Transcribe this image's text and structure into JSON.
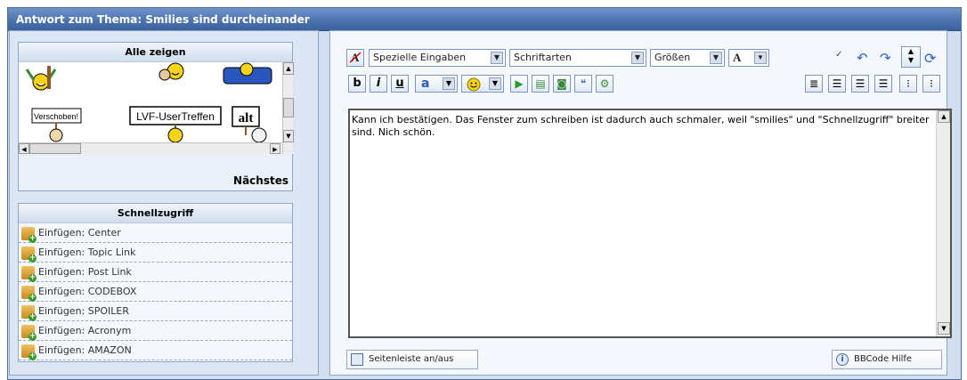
{
  "window": {
    "title": "Antwort zum Thema: Smilies sind durcheinander"
  },
  "smilies": {
    "header": "Alle zeigen",
    "items": [
      "Verschoben!",
      "LVF-UserTreffen",
      "alt"
    ],
    "next_label": "Nächstes"
  },
  "quick": {
    "header": "Schnellzugriff",
    "items": [
      "Einfügen: Center",
      "Einfügen: Topic Link",
      "Einfügen: Post Link",
      "Einfügen: CODEBOX",
      "Einfügen: SPOILER",
      "Einfügen: Acronym",
      "Einfügen: AMAZON"
    ]
  },
  "toolbar": {
    "special_select": "Spezielle Eingaben",
    "font_select": "Schriftarten",
    "size_select": "Größen",
    "color_label": "A",
    "bold_label": "b",
    "italic_label": "i",
    "underline_label": "u",
    "highlight_label": "a"
  },
  "editor": {
    "text": "Kann ich bestätigen. Das Fenster zum schreiben ist dadurch auch schmaler, weil \"smilies\" und \"Schnellzugriff\" breiter sind. Nich schön."
  },
  "bottom": {
    "sidebar_toggle": "Seitenleiste an/aus",
    "bbcode_help": "BBCode Hilfe"
  }
}
